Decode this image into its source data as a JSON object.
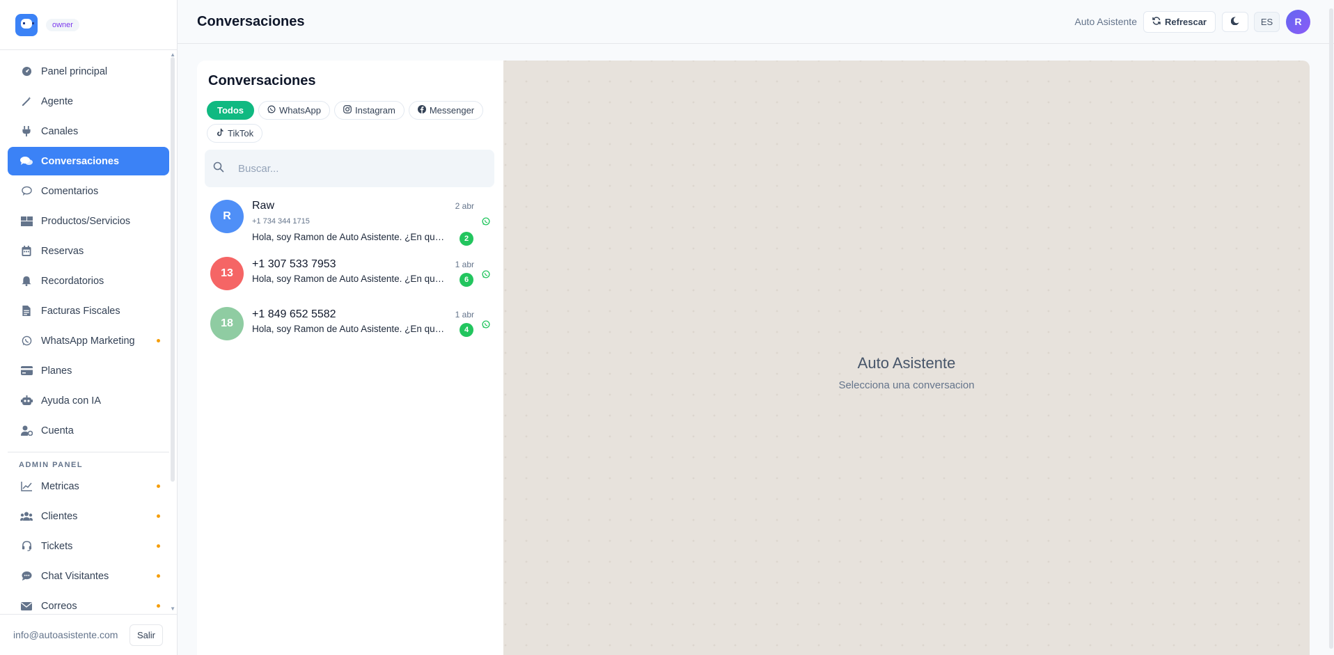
{
  "sidebar": {
    "role": "owner",
    "items": [
      {
        "label": "Panel principal",
        "icon": "gauge-icon"
      },
      {
        "label": "Agente",
        "icon": "magic-wand-icon"
      },
      {
        "label": "Canales",
        "icon": "plug-icon"
      },
      {
        "label": "Conversaciones",
        "icon": "chat-bubbles-icon",
        "active": true
      },
      {
        "label": "Comentarios",
        "icon": "comment-icon"
      },
      {
        "label": "Productos/Servicios",
        "icon": "boxes-icon"
      },
      {
        "label": "Reservas",
        "icon": "calendar-icon"
      },
      {
        "label": "Recordatorios",
        "icon": "bell-icon"
      },
      {
        "label": "Facturas Fiscales",
        "icon": "invoice-icon"
      },
      {
        "label": "WhatsApp Marketing",
        "icon": "whatsapp-icon",
        "dot": true
      },
      {
        "label": "Planes",
        "icon": "credit-card-icon"
      },
      {
        "label": "Ayuda con IA",
        "icon": "robot-icon"
      },
      {
        "label": "Cuenta",
        "icon": "user-gear-icon"
      }
    ],
    "admin_section": "ADMIN PANEL",
    "admin_items": [
      {
        "label": "Metricas",
        "icon": "line-chart-icon",
        "dot": true
      },
      {
        "label": "Clientes",
        "icon": "users-icon",
        "dot": true
      },
      {
        "label": "Tickets",
        "icon": "headset-icon",
        "dot": true
      },
      {
        "label": "Chat Visitantes",
        "icon": "comment-dots-icon",
        "dot": true
      },
      {
        "label": "Correos",
        "icon": "envelope-icon",
        "dot": true
      }
    ],
    "email": "info@autoasistente.com",
    "logout_label": "Salir"
  },
  "header": {
    "title": "Conversaciones",
    "brand": "Auto Asistente",
    "refresh_label": "Refrescar",
    "lang": "ES",
    "avatar_initial": "R"
  },
  "conversations": {
    "title": "Conversaciones",
    "filters": [
      {
        "label": "Todos",
        "active": true
      },
      {
        "label": "WhatsApp",
        "icon": "whatsapp-icon"
      },
      {
        "label": "Instagram",
        "icon": "instagram-icon"
      },
      {
        "label": "Messenger",
        "icon": "facebook-icon"
      },
      {
        "label": "TikTok",
        "icon": "tiktok-icon"
      }
    ],
    "search_placeholder": "Buscar...",
    "items": [
      {
        "initials": "R",
        "name": "Raw",
        "phone": "+1 734 344 1715",
        "message": "Hola, soy Ramon de Auto Asistente. ¿En qué puedo ayudarte?",
        "date": "2 abr",
        "unread": "2",
        "color": "#4f8ff7",
        "channel": "whatsapp-icon"
      },
      {
        "initials": "13",
        "name": "+1 307 533 7953",
        "phone": "",
        "message": "Hola, soy Ramon de Auto Asistente. ¿En qué puedo ayudarte?",
        "date": "1 abr",
        "unread": "6",
        "color": "#f56565",
        "channel": "whatsapp-icon"
      },
      {
        "initials": "18",
        "name": "+1 849 652 5582",
        "phone": "",
        "message": "Hola, soy Ramon de Auto Asistente. ¿En qué puedo ayudarte?",
        "date": "1 abr",
        "unread": "4",
        "color": "#8fcca2",
        "channel": "whatsapp-icon"
      }
    ]
  },
  "chat": {
    "empty_title": "Auto Asistente",
    "empty_subtitle": "Selecciona una conversacion"
  }
}
